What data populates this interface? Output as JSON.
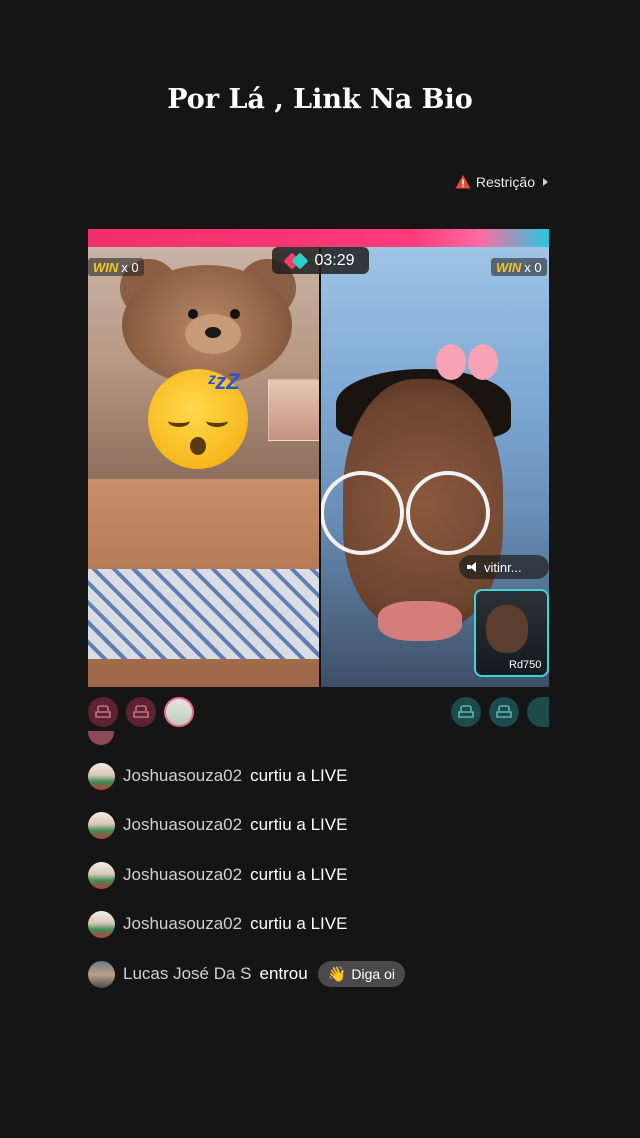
{
  "header": {
    "title": "Por Lá , Link Na Bio"
  },
  "restriction": {
    "label": "Restrição",
    "icon": "warning-icon",
    "icon_color": "#e8453c"
  },
  "live": {
    "timer": "03:29",
    "left_win_label": "WIN",
    "left_win_count": "x 0",
    "right_win_label": "WIN",
    "right_win_count": "x 0",
    "audio_user": "vitinr...",
    "pip_user": "Rd750",
    "battle_colors": {
      "left": "#f0306a",
      "right": "#27c7e0"
    }
  },
  "comments": [
    {
      "user": "Joshuasouza02",
      "action": "curtiu a LIVE"
    },
    {
      "user": "Joshuasouza02",
      "action": "curtiu a LIVE"
    },
    {
      "user": "Joshuasouza02",
      "action": "curtiu a LIVE"
    },
    {
      "user": "Joshuasouza02",
      "action": "curtiu a LIVE"
    }
  ],
  "join": {
    "user": "Lucas José Da S",
    "action": "entrou",
    "button_label": "Diga oi"
  }
}
